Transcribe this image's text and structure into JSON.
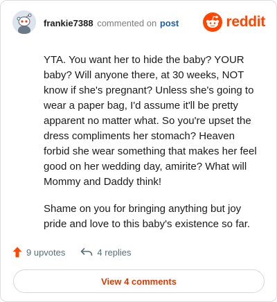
{
  "comment": {
    "username": "frankie7388",
    "action": "commented on",
    "post_link": "post",
    "paragraphs": [
      "YTA. You want her to hide the baby? YOUR baby? Will anyone there, at 30 weeks, NOT know if she's pregnant? Unless she's going to wear a paper bag, I'd assume it'll be pretty apparent no matter what. So you're upset the dress compliments her stomach? Heaven forbid she wear something that makes her feel good on her wedding day, amirite? What will Mommy and Daddy think!",
      "Shame on you for bringing anything but joy pride and love to this baby's existence so far."
    ]
  },
  "brand": {
    "name": "reddit",
    "color": "#ff4500"
  },
  "footer": {
    "upvotes": "9 upvotes",
    "replies": "4 replies",
    "view_comments": "View 4 comments"
  },
  "icons": {
    "avatar": "snoo-avatar-icon",
    "logo": "reddit-logo-icon",
    "upvote": "upvote-arrow-icon",
    "reply": "reply-arrow-icon"
  },
  "colors": {
    "accent": "#ff4500",
    "link": "#1c5fa8",
    "button_text": "#d93a00"
  }
}
